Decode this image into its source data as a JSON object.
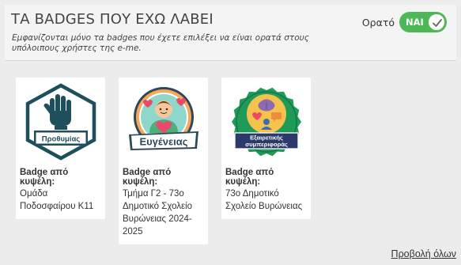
{
  "header": {
    "title": "ΤΑ BADGES ΠΟΥ ΕΧΩ ΛΑΒΕΙ",
    "description": "Εμφανίζονται μόνο τα badges που έχετε επιλέξει να είναι ορατά στους υπόλοιπους χρήστες της e-me."
  },
  "visibility": {
    "label": "Ορατό",
    "toggle_text": "ΝΑΙ",
    "enabled": true,
    "color": "#4fb856"
  },
  "badges": [
    {
      "image_text": "Προθυμίας",
      "icon": "raised-hand-hexagon-badge-icon",
      "label": "Badge από κυψέλη:",
      "source": "Ομάδα Ποδοσφαίρου Κ11"
    },
    {
      "image_text": "Ευγένειας",
      "icon": "kindness-heart-badge-icon",
      "label": "Badge από κυψέλη:",
      "source": "Τμήμα Γ2 - 73ο Δημοτικό Σχολείο Βυρώνειας 2024-2025"
    },
    {
      "image_text_line1": "Εξαιρετικής",
      "image_text_line2": "συμπεριφοράς",
      "icon": "excellent-behavior-seal-badge-icon",
      "label": "Badge από κυψέλη:",
      "source": "73ο Δημοτικό Σχολείο Βυρώνειας"
    }
  ],
  "footer": {
    "view_all": "Προβολή όλων"
  }
}
